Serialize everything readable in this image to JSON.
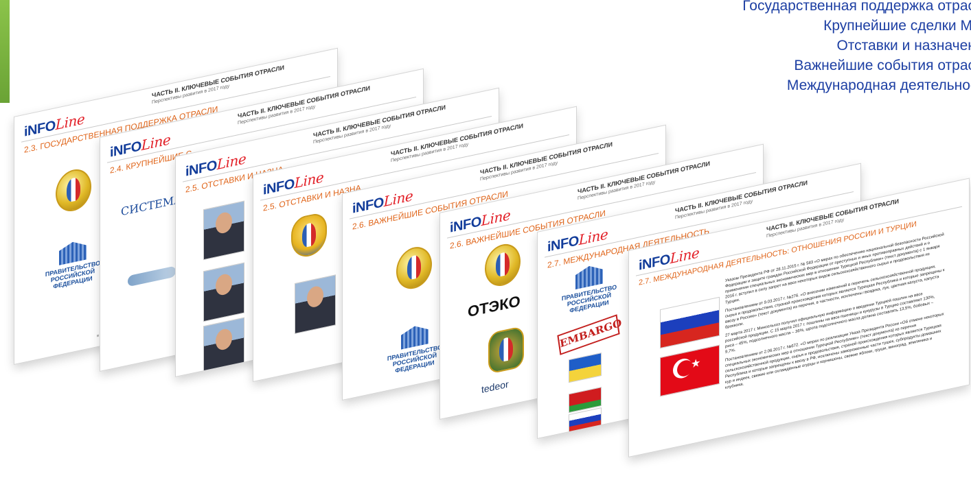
{
  "toc": {
    "items": [
      "Государственная поддержка отрасли",
      "Крупнейшие сделки M&A",
      "Отставки и назначения",
      "Важнейшие события отрасли",
      "Международная деятельность"
    ]
  },
  "slides": {
    "logo_main": "iNFO",
    "logo_line": "Line",
    "part_title": "ЧАСТЬ II. КЛЮЧЕВЫЕ СОБЫТИЯ ОТРАСЛИ",
    "part_subtitle": "Перспективы развития в 2017 году",
    "s1_heading": "2.3. ГОСУДАРСТВЕННАЯ ПОДДЕРЖКА ОТРАСЛИ",
    "s2_heading": "2.4. КРУПНЕЙШИЕ С",
    "s3_heading": "2.5. ОТСТАВКИ И НАЗНА",
    "s4_heading": "2.5. ОТСТАВКИ И НАЗНА",
    "s5_heading": "2.6. ВАЖНЕЙШИЕ СОБЫТИЯ ОТРАСЛИ",
    "s6_heading": "2.6. ВАЖНЕЙШИЕ СОБЫТИЯ ОТРАСЛИ",
    "s7_heading": "2.7. МЕЖДУНАРОДНАЯ ДЕЯТЕЛЬНОСТЬ",
    "s8_heading": "2.7. МЕЖДУНАРОДНАЯ ДЕЯТЕЛЬНОСТЬ: ОТНОШЕНИЯ РОССИИ И ТУРЦИИ",
    "gov_label": "ПРАВИТЕЛЬСТВО РОССИЙСКОЙ ФЕДЕРАЦИИ",
    "sistema": "СИСТЕМА",
    "oteko": "ОТЭКО",
    "embargo": "EMBARGO",
    "tedeor": "tedeor",
    "p1": "Указом Президента РФ от 28.11.2015 г. № 583 «О мерах по обеспечению национальной безопасности Российской Федерации и защите граждан Российской Федерации от преступных и иных противоправных действий и о применении специальных экономических мер в отношении Турецкой Республики» (текст документа) с 1 января 2016 г. вступил в силу запрет на ввоз некоторых видов сельскохозяйственного сырья и продовольствия из Турции.",
    "p2": "Постановлением от 9.03.2017 г. №276. «О внесении изменений в перечень сельскохозяйственной продукции, сырья и продовольствия, страной происхождения которых является Турецкая Республика и которые запрещены к ввозу в Россию» (текст документа) из перечня, в частности, исключены гвоздика, лук, цветная капуста, капуста брокколи.",
    "p3": "27 марта 2017 г. Минсельхоз получил официальную информацию о введении Турцией пошлин на ввоз российской продукции. С 15 марта 2017 г. пошлины на ввоз пшеницы и кукурузы в Турцию составляют 130%, риса – 45%, подсолнечного масла – 36%, шрота подсолнечного масла должна составлять 13,5%, бобовых – 9,7%.",
    "p4": "Постановлением от 2.06.2017 г. №672. «О мерах по реализации Указа Президента России «Об отмене некоторых специальных экономических мер в отношении Турецкой Республики» (текст документа) из перечня сельскохозяйственной продукции, сырья и продовольствия, страной происхождения которых является Турецкая Республика и которые запрещены к ввозу в РФ, исключены замороженные части тушек, субпродукты домашних кур и индеек, свежие или охлаждённые огурцы и корнишоны, свежие яблоки, груши, виноград, земляника и клубника."
  }
}
